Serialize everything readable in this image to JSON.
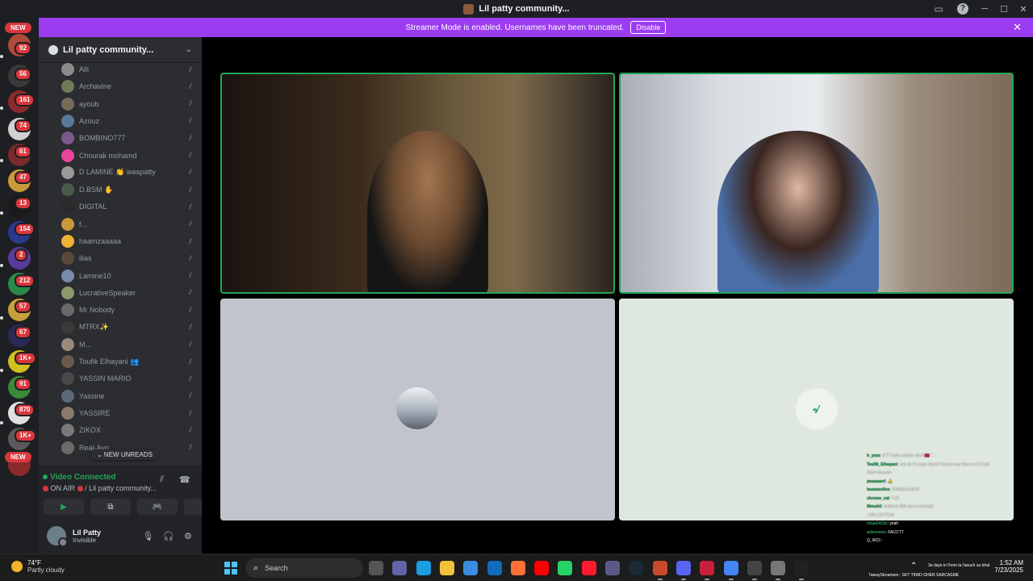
{
  "window": {
    "title": "Lil patty community...",
    "controls": {
      "minimize": "─",
      "maximize": "☐",
      "close": "✕"
    }
  },
  "banner": {
    "text": "Streamer Mode is enabled. Usernames have been truncated.",
    "button": "Disable",
    "close": "✕"
  },
  "rail": {
    "new_top": "NEW",
    "new_bottom": "NEW",
    "badges": [
      "92",
      "56",
      "161",
      "74",
      "61",
      "47",
      "13",
      "154",
      "2",
      "212",
      "57",
      "67",
      "1K+",
      "91",
      "870",
      "1K+"
    ]
  },
  "guild": {
    "name": "Lil patty community...",
    "chevron": "⌄"
  },
  "members": [
    {
      "name": "Alli",
      "color": "#8a8a8a"
    },
    {
      "name": "Archavine",
      "color": "#6f7b58"
    },
    {
      "name": "ayoub",
      "color": "#7a6a5a"
    },
    {
      "name": "Azouz",
      "color": "#5a7a9a"
    },
    {
      "name": "BOMBINO777",
      "color": "#7a5a8a"
    },
    {
      "name": "Chourak mohamd",
      "color": "#eb459e"
    },
    {
      "name": "D LAMINE 👏 waapatty",
      "color": "#9a9a9a"
    },
    {
      "name": "D.BSM ✋",
      "color": "#4a5a4a"
    },
    {
      "name": "DIGITAL",
      "color": "#2a2a2a"
    },
    {
      "name": "f...",
      "color": "#c89a3a"
    },
    {
      "name": "haamzaaaaa",
      "color": "#f0b232"
    },
    {
      "name": "ilias",
      "color": "#5a4a3a"
    },
    {
      "name": "Lamine10",
      "color": "#7a8aaa"
    },
    {
      "name": "LucrativeSpeaker",
      "color": "#8a9a6a"
    },
    {
      "name": "Mr Nobody",
      "color": "#6a6a6a"
    },
    {
      "name": "MTRX✨",
      "color": "#3a3a3a"
    },
    {
      "name": "M...",
      "color": "#9a8a7a"
    },
    {
      "name": "Toufik Elhayani 👥",
      "color": "#6a5a4a"
    },
    {
      "name": "YASSIN MARIO",
      "color": "#4a4a4a"
    },
    {
      "name": "Yassine",
      "color": "#5a6a7a"
    },
    {
      "name": "YASSIRE",
      "color": "#8a7a6a"
    },
    {
      "name": "ZIKOX",
      "color": "#7a7a7a"
    },
    {
      "name": "Real-Ayo",
      "color": "#6a6a6a"
    }
  ],
  "new_unreads": "⌄ NEW UNREADS",
  "voice": {
    "status": "Video Connected",
    "subtitle": "ON AIR",
    "channel": "/ Lil patty community...",
    "buttons": [
      "▶",
      "⧉",
      "🎮",
      "✦"
    ]
  },
  "user": {
    "name": "Lil Patty",
    "status": "Invisible"
  },
  "overlay": {
    "lines": [
      {
        "user": "h_ysss",
        "text": ": KTT bs3d saikhar khali 🇲🇦 ❤"
      },
      {
        "user": "Toufik_Elhayani",
        "text": ": nah ils t2 yaaru 3ayet l'france mon kilwa w le7 batl"
      },
      {
        "user": "",
        "text": "Siare mazyan"
      },
      {
        "user": "pwaaaarrl",
        "text": ": 🙏"
      },
      {
        "user": "hassanellos",
        "text": ": DKMAAA MCN"
      },
      {
        "user": "chrome_cat",
        "text": ": TLR"
      },
      {
        "user": "Nimuhii",
        "text": ": wellkom 500 ans w average"
      },
      {
        "user": "",
        "text": ": DRI CHYTON"
      },
      {
        "user": "ninja3419x",
        "text": ": yeah"
      },
      {
        "user": "ankonmm",
        "text": ": FACCTT"
      },
      {
        "user": "",
        "text": "Q_W23 :"
      }
    ],
    "footer": "7awayStreamers : SKT T9WD GHER SARCASME"
  },
  "taskbar": {
    "weather_temp": "74°F",
    "weather_desc": "Partly cloudy",
    "search_placeholder": "Search",
    "tray_chevron": "⌃",
    "ticker": "3a days in l'hom la l'aouch ou bhal",
    "time": "1:52 AM",
    "date": "7/23/2025"
  },
  "colors": {
    "banner": "#9b3cf0",
    "speaking": "#23a55a",
    "badge": "#da373c",
    "start": "#4cc2ff"
  }
}
